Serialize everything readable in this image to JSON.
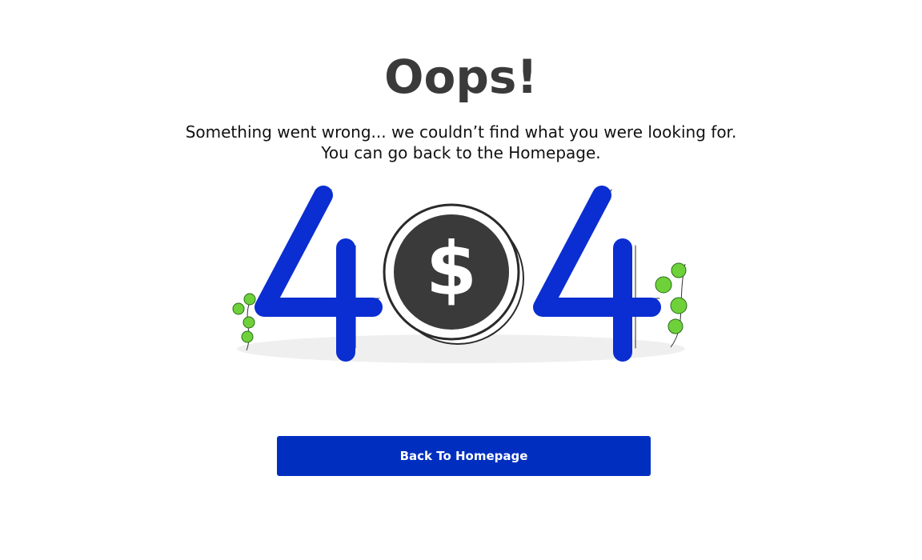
{
  "error_page": {
    "title": "Oops!",
    "message_line1": "Something went wrong... we couldn’t find what you were looking for.",
    "message_line2": "You can go back to the Homepage.",
    "illustration_digits": [
      "4",
      "4"
    ],
    "coin_symbol": "$",
    "button_label": "Back To Homepage"
  },
  "colors": {
    "primary": "#002fc0",
    "digit_blue": "#0a2ed1",
    "coin_dark": "#3a3a3a",
    "title_gray": "#3a3a3a",
    "leaf_green": "#6fd13a",
    "shadow_gray": "#efefef"
  },
  "icons": {
    "illustration": "404-coin-illustration",
    "coin": "dollar-coin-icon",
    "plants": "vine-leaves-icon"
  }
}
